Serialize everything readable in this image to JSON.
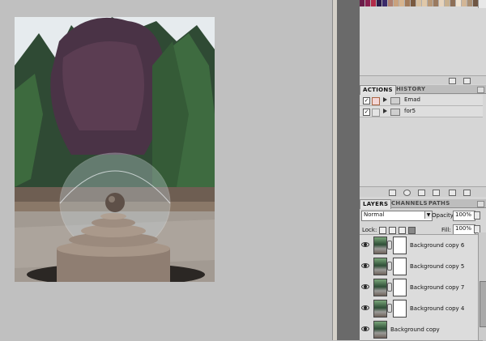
{
  "swatch_colors": [
    "#6b1d4a",
    "#8a2050",
    "#b12b49",
    "#2b1b4a",
    "#3b2a6a",
    "#b08070",
    "#c9a27e",
    "#d6b48f",
    "#a17a5a",
    "#7a5a40",
    "#d8c0a0",
    "#e0c8a8",
    "#b89878",
    "#9a7a60",
    "#e7d4bd",
    "#c8b08f",
    "#8e6f56",
    "#f0e2cf",
    "#d2b696",
    "#a98f74",
    "#6f5643"
  ],
  "actions_panel": {
    "tabs": [
      "ACTIONS",
      "HISTORY"
    ],
    "items": [
      {
        "label": "Emad",
        "checked": true
      },
      {
        "label": "for5",
        "checked": true
      }
    ]
  },
  "layers_panel": {
    "tabs": [
      "LAYERS",
      "CHANNELS",
      "PATHS"
    ],
    "blend_mode": "Normal",
    "opacity_label": "Opacity:",
    "opacity_value": "100%",
    "lock_label": "Lock:",
    "fill_label": "Fill:",
    "fill_value": "100%",
    "layers": [
      {
        "name": "Background copy 6",
        "visible": true,
        "has_mask": true
      },
      {
        "name": "Background copy 5",
        "visible": true,
        "has_mask": true
      },
      {
        "name": "Background copy 7",
        "visible": true,
        "has_mask": true
      },
      {
        "name": "Background copy 4",
        "visible": true,
        "has_mask": true
      },
      {
        "name": "Background copy",
        "visible": true,
        "has_mask": false
      }
    ]
  }
}
